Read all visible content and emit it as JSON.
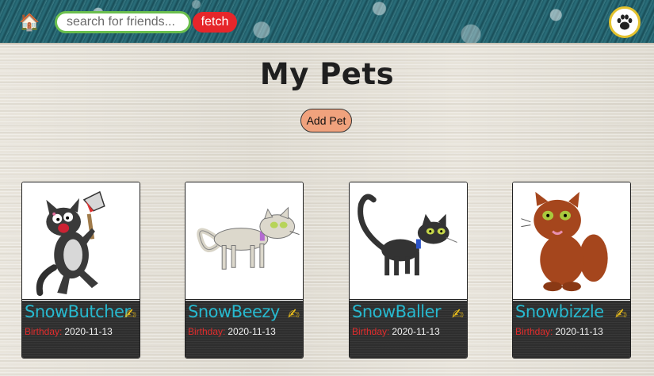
{
  "navbar": {
    "home_icon": "🏠",
    "search_placeholder": "search for friends...",
    "fetch_label": "fetch",
    "avatar_icon": "paw-icon"
  },
  "main": {
    "title": "My Pets",
    "add_pet_label": "Add Pet"
  },
  "pets": [
    {
      "name": "SnowButcher",
      "birthday_label": "Birthday:",
      "birthday": "2020-11-13",
      "edit_icon": "✍"
    },
    {
      "name": "SnowBeezy",
      "birthday_label": "Birthday:",
      "birthday": "2020-11-13",
      "edit_icon": "✍"
    },
    {
      "name": "SnowBaller",
      "birthday_label": "Birthday:",
      "birthday": "2020-11-13",
      "edit_icon": "✍"
    },
    {
      "name": "Snowbizzle",
      "birthday_label": "Birthday:",
      "birthday": "2020-11-13",
      "edit_icon": "✍"
    }
  ],
  "colors": {
    "navbar": "#1f5e69",
    "fetch_button": "#e6262a",
    "search_border": "#6bbf4e",
    "avatar_border": "#e3c22e",
    "add_pet_button": "#f0a27d",
    "pet_name": "#27b9cf",
    "birthday_label": "#e32c2c",
    "edit_icon": "#f4c51a"
  }
}
